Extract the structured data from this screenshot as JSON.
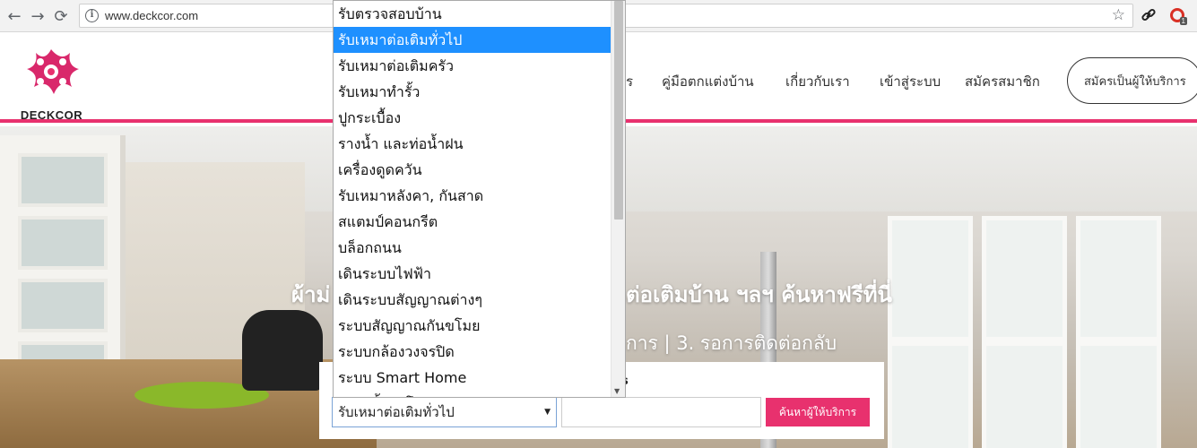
{
  "browser": {
    "url": "www.deckcor.com",
    "back_icon": "←",
    "forward_icon": "→",
    "reload_icon": "⟳",
    "info_icon": "i",
    "bookmark_icon": "☆",
    "link_icon": "🔗",
    "extension_badge": "1"
  },
  "site": {
    "brand_name": "DECKCOR",
    "brand_color": "#e8316e",
    "nav": {
      "partial_item": "ร",
      "guide": "คู่มือตกแต่งบ้าน",
      "about": "เกี่ยวกับเรา",
      "login": "เข้าสู่ระบบ",
      "register": "สมัครสมาชิก",
      "provider_signup": "สมัครเป็นผู้ให้บริการ"
    }
  },
  "hero": {
    "title_left": "ผ้าม่",
    "title_right": "ต่อเติมบ้าน ฯลฯ ค้นหาฟรีที่นี่",
    "subtitle_right": "การ | 3. รอการติดต่อกลับ"
  },
  "search": {
    "label_fragment": "s",
    "selected_value": "รับเหมาต่อเติมทั่วไป",
    "select_arrow": "▼",
    "text_value": "",
    "button_label": "ค้นหาผู้ให้บริการ"
  },
  "dropdown": {
    "items": [
      "รับตรวจสอบบ้าน",
      "รับเหมาต่อเติมทั่วไป",
      "รับเหมาต่อเติมครัว",
      "รับเหมาทำรั้ว",
      "ปูกระเบื้อง",
      "รางน้ำ และท่อน้ำฝน",
      "เครื่องดูดควัน",
      "รับเหมาหลังคา, กันสาด",
      "สแตมป์คอนกรีต",
      "บล็อกถนน",
      "เดินระบบไฟฟ้า",
      "เดินระบบสัญญาณต่างๆ",
      "ระบบสัญญาณกันขโมย",
      "ระบบกล้องวงจรปิด",
      "ระบบ Smart Home",
      "ประตูรั้วอัตโนมัติ"
    ],
    "selected_index": 1,
    "scroll_down_icon": "▼"
  }
}
